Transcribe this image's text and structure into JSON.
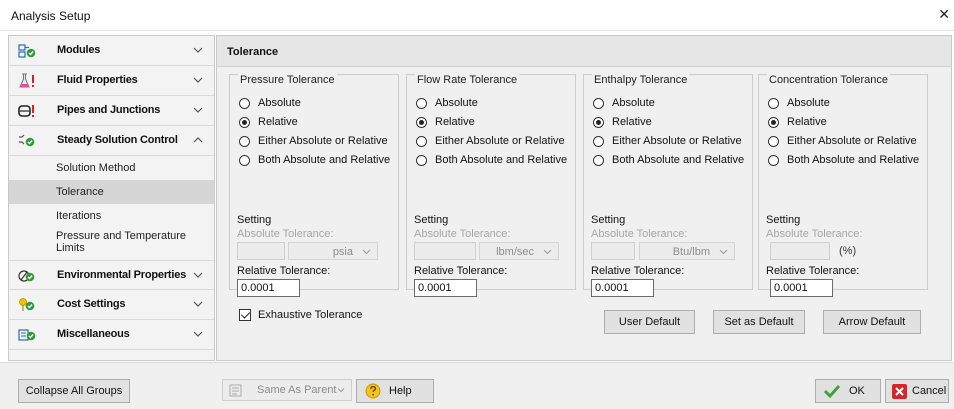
{
  "window": {
    "title": "Analysis Setup",
    "close_glyph": "✕"
  },
  "sidebar": {
    "groups": [
      {
        "label": "Modules",
        "icon": "modules-icon"
      },
      {
        "label": "Fluid Properties",
        "icon": "flask-icon"
      },
      {
        "label": "Pipes and Junctions",
        "icon": "pipes-icon"
      },
      {
        "label": "Steady Solution Control",
        "icon": "solution-control-icon"
      },
      {
        "label": "Environmental Properties",
        "icon": "environment-icon"
      },
      {
        "label": "Cost Settings",
        "icon": "cost-icon"
      },
      {
        "label": "Miscellaneous",
        "icon": "misc-icon"
      }
    ],
    "sub_items": [
      {
        "label": "Solution Method"
      },
      {
        "label": "Tolerance",
        "selected": true
      },
      {
        "label": "Iterations"
      },
      {
        "label": "Pressure and Temperature Limits"
      }
    ]
  },
  "main": {
    "heading": "Tolerance",
    "radio_options": [
      "Absolute",
      "Relative",
      "Either Absolute or Relative",
      "Both Absolute and Relative"
    ],
    "setting_label": "Setting",
    "absolute_label": "Absolute Tolerance:",
    "relative_label": "Relative Tolerance:",
    "groups": [
      {
        "title": "Pressure Tolerance",
        "selected": "Relative",
        "unit": "psia",
        "relative_value": "0.0001"
      },
      {
        "title": "Flow Rate Tolerance",
        "selected": "Relative",
        "unit": "lbm/sec",
        "relative_value": "0.0001"
      },
      {
        "title": "Enthalpy Tolerance",
        "selected": "Relative",
        "unit": "Btu/lbm",
        "relative_value": "0.0001"
      },
      {
        "title": "Concentration Tolerance",
        "selected": "Relative",
        "unit": "(%)",
        "relative_value": "0.0001"
      }
    ],
    "exhaustive_label": "Exhaustive Tolerance",
    "exhaustive_checked": true,
    "buttons": {
      "user_default": "User Default",
      "set_default": "Set as Default",
      "arrow_default": "Arrow Default"
    }
  },
  "footer": {
    "collapse_label": "Collapse All Groups",
    "parent_label": "Same As Parent",
    "help_label": "Help",
    "ok_label": "OK",
    "cancel_label": "Cancel"
  },
  "colors": {
    "ok_check": "#3aa53a",
    "cancel_x": "#d7262b",
    "accent_green": "#2e9c3a",
    "flask": "#e0509a",
    "warning_red": "#e01f1f"
  }
}
